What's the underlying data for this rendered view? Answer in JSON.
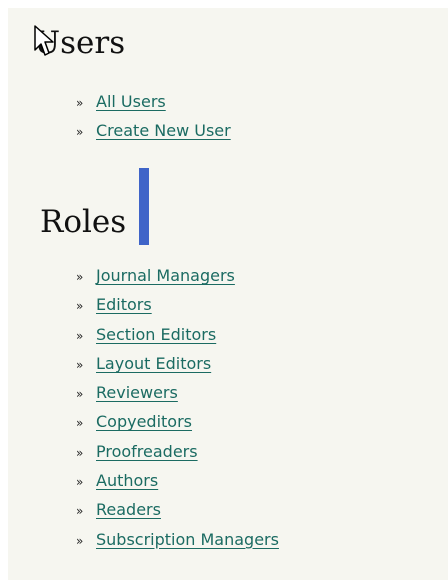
{
  "users": {
    "heading": "Users",
    "items": [
      {
        "bullet": "»",
        "label": "All Users"
      },
      {
        "bullet": "»",
        "label": "Create New User"
      }
    ]
  },
  "roles": {
    "heading": "Roles",
    "items": [
      {
        "bullet": "»",
        "label": "Journal Managers"
      },
      {
        "bullet": "»",
        "label": "Editors"
      },
      {
        "bullet": "»",
        "label": "Section Editors"
      },
      {
        "bullet": "»",
        "label": "Layout Editors"
      },
      {
        "bullet": "»",
        "label": "Reviewers"
      },
      {
        "bullet": "»",
        "label": "Copyeditors"
      },
      {
        "bullet": "»",
        "label": "Proofreaders"
      },
      {
        "bullet": "»",
        "label": "Authors"
      },
      {
        "bullet": "»",
        "label": "Readers"
      },
      {
        "bullet": "»",
        "label": "Subscription Managers"
      }
    ]
  },
  "icons": {
    "cursor": "mouse-pointer-icon",
    "caret": "text-caret"
  },
  "colors": {
    "link": "#1b6b62",
    "heading": "#111111",
    "background": "#f6f6f0",
    "caret": "#3f64c8"
  }
}
